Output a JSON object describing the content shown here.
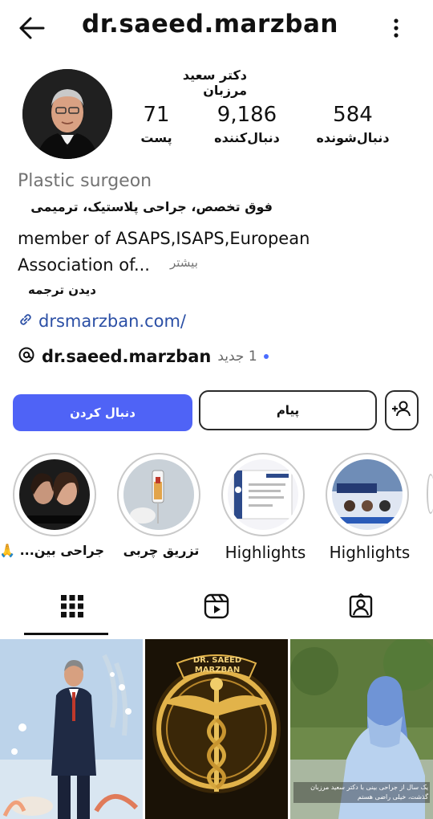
{
  "header": {
    "username": "dr.saeed.marzban",
    "back_icon": "arrow-left-icon",
    "more_icon": "more-vertical-icon"
  },
  "profile": {
    "display_name": "دکتر سعید مرزبان",
    "stats": {
      "posts": {
        "value": "71",
        "label": "پست"
      },
      "followers": {
        "value": "9,186",
        "label": "دنبال‌کننده"
      },
      "following": {
        "value": "584",
        "label": "دنبال‌شونده"
      }
    },
    "category": "Plastic surgeon",
    "bio_fa": "فوق تخصص، جراحی پلاستیک، ترمیمی",
    "bio_en_line1": "member of ASAPS,ISAPS,European",
    "bio_en_line2": "Association of...",
    "bio_more": "بیشتر",
    "translate": "دیدن ترجمه",
    "link": "drsmarzban.com/",
    "threads_handle": "dr.saeed.marzban",
    "threads_badge": "1 جدید"
  },
  "actions": {
    "follow_label": "دنبال کردن",
    "message_label": "پیام",
    "add_user_icon": "add-user-icon"
  },
  "highlights": [
    {
      "label": "جراحی بین... 🙏"
    },
    {
      "label": "تزریق چربی"
    },
    {
      "label": "Highlights"
    },
    {
      "label": "Highlights"
    }
  ],
  "tabs": [
    {
      "icon": "grid-icon",
      "active": true
    },
    {
      "icon": "reels-icon",
      "active": false
    },
    {
      "icon": "tagged-icon",
      "active": false
    }
  ],
  "posts": [
    {
      "caption": ""
    },
    {
      "caption": "DR. SAEED MARZBAN"
    },
    {
      "caption": "یک سال از جراحی بینی با دکتر سعید مرزبان گذشت، خیلی راضی هستم"
    }
  ],
  "colors": {
    "accent": "#4f63f6",
    "link": "#2b4fa5",
    "muted": "#737373"
  }
}
